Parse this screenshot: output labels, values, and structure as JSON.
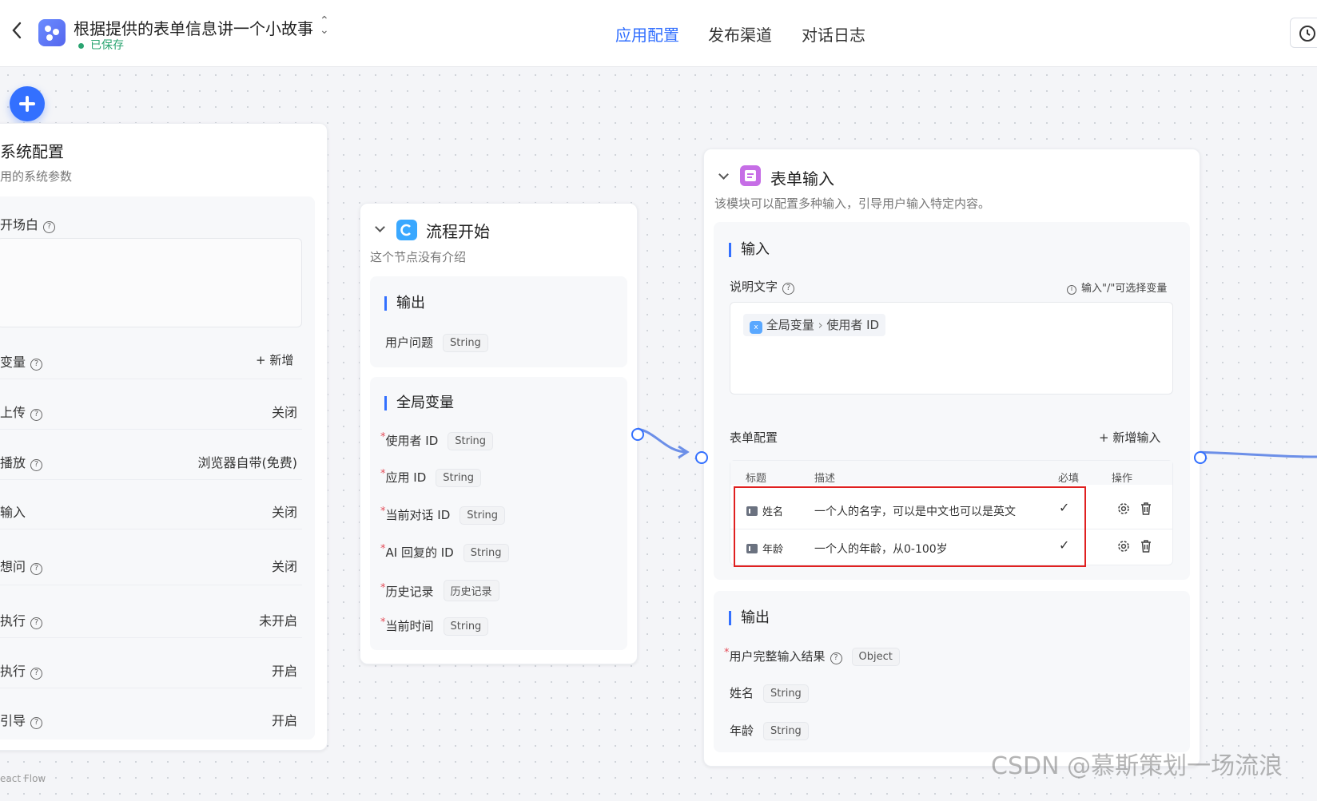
{
  "header": {
    "app_title": "根据提供的表单信息讲一个小故事",
    "saved_status": "已保存",
    "tabs": [
      {
        "label": "应用配置",
        "active": true
      },
      {
        "label": "发布渠道",
        "active": false
      },
      {
        "label": "对话日志",
        "active": false
      }
    ],
    "icons": {
      "back": "chevron-left-icon",
      "history": "clock-icon"
    }
  },
  "system_config": {
    "title": "系统配置",
    "desc": "用的系统参数",
    "opening": "开场白",
    "variables": {
      "label": "变量",
      "action": "+ 新增"
    },
    "rows": [
      {
        "label": "上传",
        "value": "关闭"
      },
      {
        "label": "播放",
        "value": "浏览器自带(免费)"
      },
      {
        "label": "输入",
        "value": "关闭"
      },
      {
        "label": "想问",
        "value": "关闭"
      },
      {
        "label": "执行",
        "value": "未开启"
      },
      {
        "label": "执行",
        "value": "开启"
      },
      {
        "label": "引导",
        "value": "开启"
      }
    ]
  },
  "flow_start": {
    "title": "流程开始",
    "desc": "这个节点没有介绍",
    "output": {
      "title": "输出",
      "items": [
        {
          "label": "用户问题",
          "type": "String"
        }
      ]
    },
    "globals": {
      "title": "全局变量",
      "items": [
        {
          "label": "使用者 ID",
          "type": "String"
        },
        {
          "label": "应用 ID",
          "type": "String"
        },
        {
          "label": "当前对话 ID",
          "type": "String"
        },
        {
          "label": "AI 回复的 ID",
          "type": "String"
        },
        {
          "label": "历史记录",
          "type": "历史记录"
        },
        {
          "label": "当前时间",
          "type": "String"
        }
      ]
    }
  },
  "form_input": {
    "title": "表单输入",
    "desc": "该模块可以配置多种输入，引导用户输入特定内容。",
    "input": {
      "title": "输入",
      "desc_label": "说明文字",
      "hint": "输入\"/\"可选择变量",
      "chip_scope": "全局变量",
      "chip_sep": "›",
      "chip_var": "使用者 ID",
      "form_config_label": "表单配置",
      "add_input": "+ 新增输入",
      "table": {
        "headers": [
          "标题",
          "描述",
          "必填",
          "操作"
        ],
        "rows": [
          {
            "title": "姓名",
            "desc": "一个人的名字，可以是中文也可以是英文",
            "required": "✓"
          },
          {
            "title": "年龄",
            "desc": "一个人的年龄，从0-100岁",
            "required": "✓"
          }
        ]
      }
    },
    "output": {
      "title": "输出",
      "items": [
        {
          "label": "用户完整输入结果",
          "type": "Object"
        },
        {
          "label": "姓名",
          "type": "String"
        },
        {
          "label": "年龄",
          "type": "String"
        }
      ]
    }
  },
  "footer": {
    "react_flow": "eact Flow",
    "watermark": "CSDN @慕斯策划一场流浪"
  },
  "colors": {
    "accent": "#3370ff",
    "saved": "#2ba471",
    "highlight": "#e02020"
  }
}
